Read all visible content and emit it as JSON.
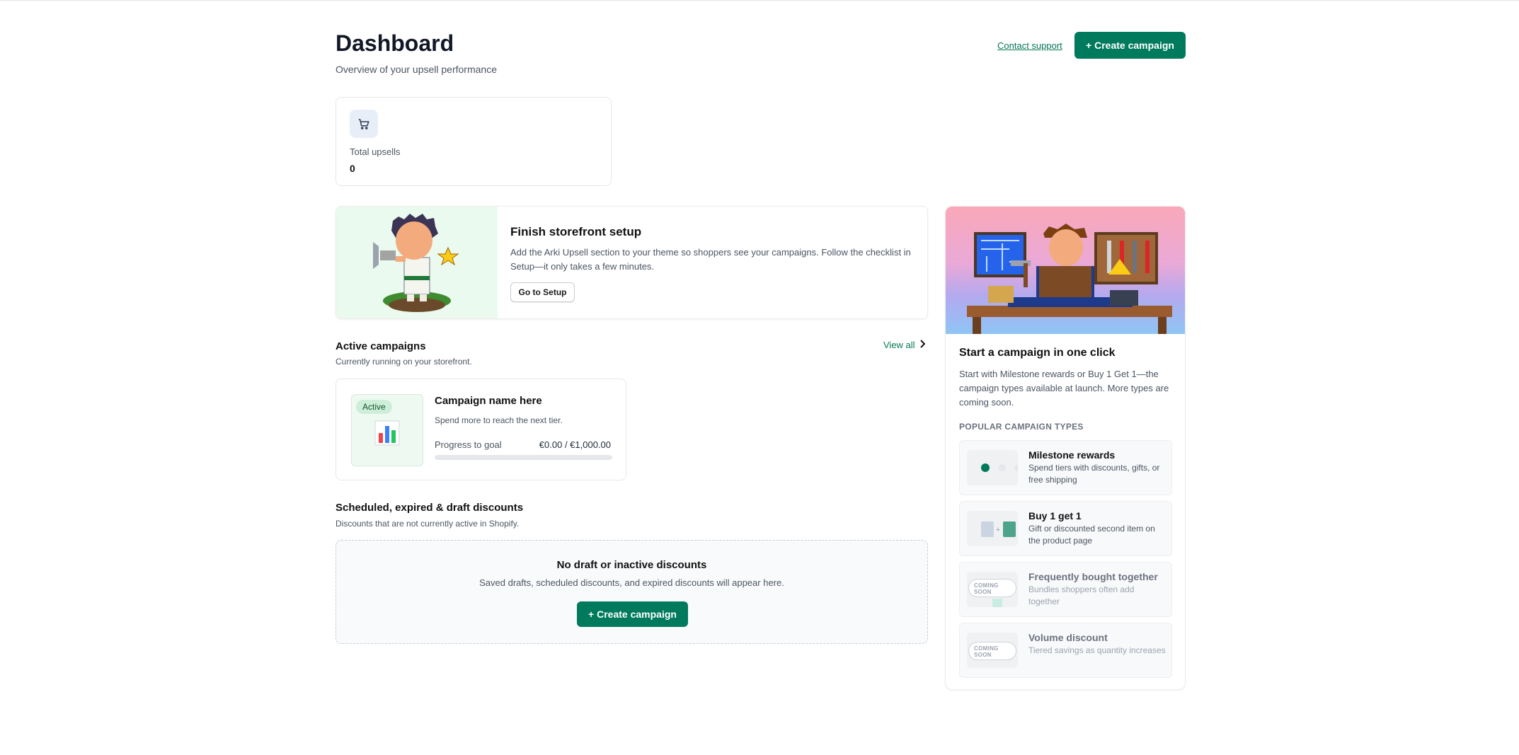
{
  "header": {
    "title": "Dashboard",
    "subtitle": "Overview of your upsell performance",
    "support_label": "Contact support",
    "create_label": "+ Create campaign"
  },
  "stats": {
    "icon": "cart-icon",
    "label": "Total upsells",
    "value": "0"
  },
  "setup": {
    "title": "Finish storefront setup",
    "description": "Add the Arki Upsell section to your theme so shoppers see your campaigns. Follow the checklist in Setup—it only takes a few minutes.",
    "button_label": "Go to Setup"
  },
  "active_campaigns": {
    "title": "Active campaigns",
    "subtitle": "Currently running on your storefront.",
    "view_all_label": "View all",
    "items": [
      {
        "status": "Active",
        "name": "Campaign name here",
        "description": "Spend more to reach the next tier.",
        "progress_label": "Progress to goal",
        "progress_value": "€0.00 / €1,000.00",
        "progress_fraction": 0
      }
    ]
  },
  "scheduled": {
    "title": "Scheduled, expired & draft discounts",
    "subtitle": "Discounts that are not currently active in Shopify.",
    "empty_title": "No draft or inactive discounts",
    "empty_subtitle": "Saved drafts, scheduled discounts, and expired discounts will appear here.",
    "create_label": "+ Create campaign"
  },
  "side": {
    "title": "Start a campaign in one click",
    "description": "Start with Milestone rewards or Buy 1 Get 1—the campaign types available at launch. More types are coming soon.",
    "section_label": "POPULAR CAMPAIGN TYPES",
    "types": [
      {
        "name": "Milestone rewards",
        "description": "Spend tiers with discounts, gifts, or free shipping",
        "available": true
      },
      {
        "name": "Buy 1 get 1",
        "description": "Gift or discounted second item on the product page",
        "available": true
      },
      {
        "name": "Frequently bought together",
        "description": "Bundles shoppers often add together",
        "available": false,
        "badge_line1": "COMING",
        "badge_line2": "SOON"
      },
      {
        "name": "Volume discount",
        "description": "Tiered savings as quantity increases",
        "available": false,
        "badge_line1": "COMING",
        "badge_line2": "SOON"
      }
    ]
  },
  "colors": {
    "primary": "#007a5c",
    "link": "#047857",
    "setup_bg": "#ebfaee",
    "badge_bg": "#cdeed8"
  }
}
